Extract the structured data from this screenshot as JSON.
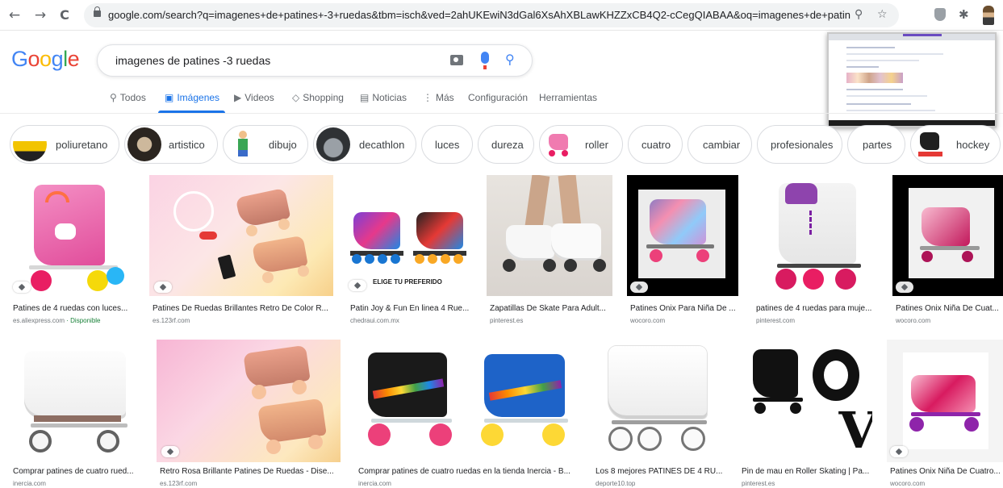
{
  "browser": {
    "url": "google.com/search?q=imagenes+de+patines+-3+ruedas&tbm=isch&ved=2ahUKEwiN3dGal6XsAhXBLawKHZZxCB4Q2-cCegQIABAA&oq=imagenes+de+patines...",
    "back_icon": "←",
    "forward_icon": "→",
    "reload_icon": "C",
    "zoom_icon": "⚲",
    "star_icon": "☆",
    "puzzle_icon": "✱"
  },
  "logo": {
    "letters": [
      "G",
      "o",
      "o",
      "g",
      "l",
      "e"
    ],
    "colors": [
      "#4285f4",
      "#ea4335",
      "#fbbc05",
      "#4285f4",
      "#34a853",
      "#ea4335"
    ]
  },
  "search": {
    "query": "imagenes de patines -3 ruedas",
    "search_icon": "⚲"
  },
  "tabs": [
    {
      "icon": "⚲",
      "label": "Todos",
      "active": false
    },
    {
      "icon": "▣",
      "label": "Imágenes",
      "active": true
    },
    {
      "icon": "▶",
      "label": "Videos",
      "active": false
    },
    {
      "icon": "◇",
      "label": "Shopping",
      "active": false
    },
    {
      "icon": "▤",
      "label": "Noticias",
      "active": false
    },
    {
      "icon": "⋮",
      "label": "Más",
      "active": false
    },
    {
      "icon": "",
      "label": "Configuración",
      "active": false
    },
    {
      "icon": "",
      "label": "Herramientas",
      "active": false
    }
  ],
  "chips": [
    {
      "label": "poliuretano",
      "thumb": true
    },
    {
      "label": "artistico",
      "thumb": true
    },
    {
      "label": "dibujo",
      "thumb": true
    },
    {
      "label": "decathlon",
      "thumb": true
    },
    {
      "label": "luces",
      "thumb": false
    },
    {
      "label": "dureza",
      "thumb": false
    },
    {
      "label": "roller",
      "thumb": true
    },
    {
      "label": "cuatro",
      "thumb": false
    },
    {
      "label": "cambiar",
      "thumb": false
    },
    {
      "label": "profesionales",
      "thumb": false
    },
    {
      "label": "partes",
      "thumb": false
    },
    {
      "label": "hockey",
      "thumb": true
    }
  ],
  "results_row1": [
    {
      "title": "Patines de 4 ruedas con luces...",
      "source": "es.aliexpress.com",
      "extra": "· Disponible"
    },
    {
      "title": "Patines De Ruedas Brillantes Retro De Color R...",
      "source": "es.123rf.com",
      "extra": ""
    },
    {
      "title": "Patin Joy & Fun En linea 4 Rue...",
      "source": "chedraui.com.mx",
      "extra": "",
      "overlay": "ELIGE TU PREFERIDO"
    },
    {
      "title": "Zapatillas De Skate Para Adult...",
      "source": "pinterest.es",
      "extra": ""
    },
    {
      "title": "Patines Onix Para Niña De ...",
      "source": "wocoro.com",
      "extra": ""
    },
    {
      "title": "patines de 4 ruedas para muje...",
      "source": "pinterest.com",
      "extra": ""
    },
    {
      "title": "Patines Onix Niña De Cuat...",
      "source": "wocoro.com",
      "extra": ""
    }
  ],
  "results_row2": [
    {
      "title": "Comprar patines de cuatro rued...",
      "source": "inercia.com"
    },
    {
      "title": "Retro Rosa Brillante Patines De Ruedas - Dise...",
      "source": "es.123rf.com"
    },
    {
      "title": "Comprar patines de cuatro ruedas en la tienda Inercia - B...",
      "source": "inercia.com"
    },
    {
      "title": "Los 8 mejores PATINES DE 4 RU...",
      "source": "deporte10.top"
    },
    {
      "title": "Pin de mau en Roller Skating | Pa...",
      "source": "pinterest.es",
      "art": "LOVE"
    },
    {
      "title": "Patines Onix Niña De Cuatro...",
      "source": "wocoro.com"
    }
  ]
}
